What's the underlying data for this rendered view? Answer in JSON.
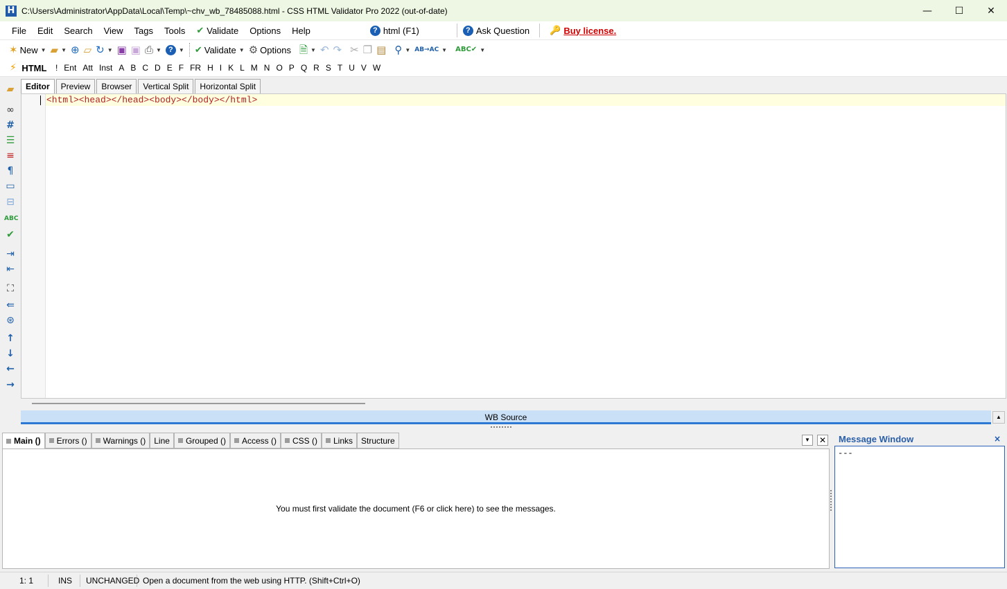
{
  "window": {
    "title": "C:\\Users\\Administrator\\AppData\\Local\\Temp\\~chv_wb_78485088.html - CSS HTML Validator Pro 2022 (out-of-date)",
    "app_icon_letter": "H",
    "minimize": "—",
    "maximize": "☐",
    "close": "✕"
  },
  "menu": {
    "items": [
      "File",
      "Edit",
      "Search",
      "View",
      "Tags",
      "Tools"
    ],
    "validate": "Validate",
    "options": "Options",
    "help": "Help",
    "html_help": "html (F1)",
    "ask_question": "Ask Question",
    "buy_license": "Buy license."
  },
  "toolbar": {
    "new_label": "New",
    "validate_label": "Validate",
    "options_label": "Options"
  },
  "tagbar": {
    "html_label": "HTML",
    "tags": [
      "!",
      "Ent",
      "Att",
      "Inst",
      "A",
      "B",
      "C",
      "D",
      "E",
      "F",
      "FR",
      "H",
      "I",
      "K",
      "L",
      "M",
      "N",
      "O",
      "P",
      "Q",
      "R",
      "S",
      "T",
      "U",
      "V",
      "W"
    ]
  },
  "editor_tabs": [
    "Editor",
    "Preview",
    "Browser",
    "Vertical Split",
    "Horizontal Split"
  ],
  "editor": {
    "code": "<html><head></head><body></body></html>"
  },
  "wb_source": "WB Source",
  "message_tabs": [
    "Main ()",
    "Errors ()",
    "Warnings ()",
    "Line",
    "Grouped ()",
    "Access ()",
    "CSS ()",
    "Links",
    "Structure"
  ],
  "messages": {
    "info": "You must first validate the document (F6 or click here) to see the messages."
  },
  "message_window": {
    "title": "Message Window",
    "close": "×",
    "content": "---"
  },
  "status": {
    "position": "1: 1",
    "mode": "INS",
    "state": "UNCHANGED",
    "hint": "Open a document from the web using HTTP. (Shift+Ctrl+O)"
  },
  "colors": {
    "title_bg": "#eef7e3",
    "accent_blue": "#2b79d3",
    "code_tag": "#b02020",
    "buy_license": "#d00000"
  }
}
